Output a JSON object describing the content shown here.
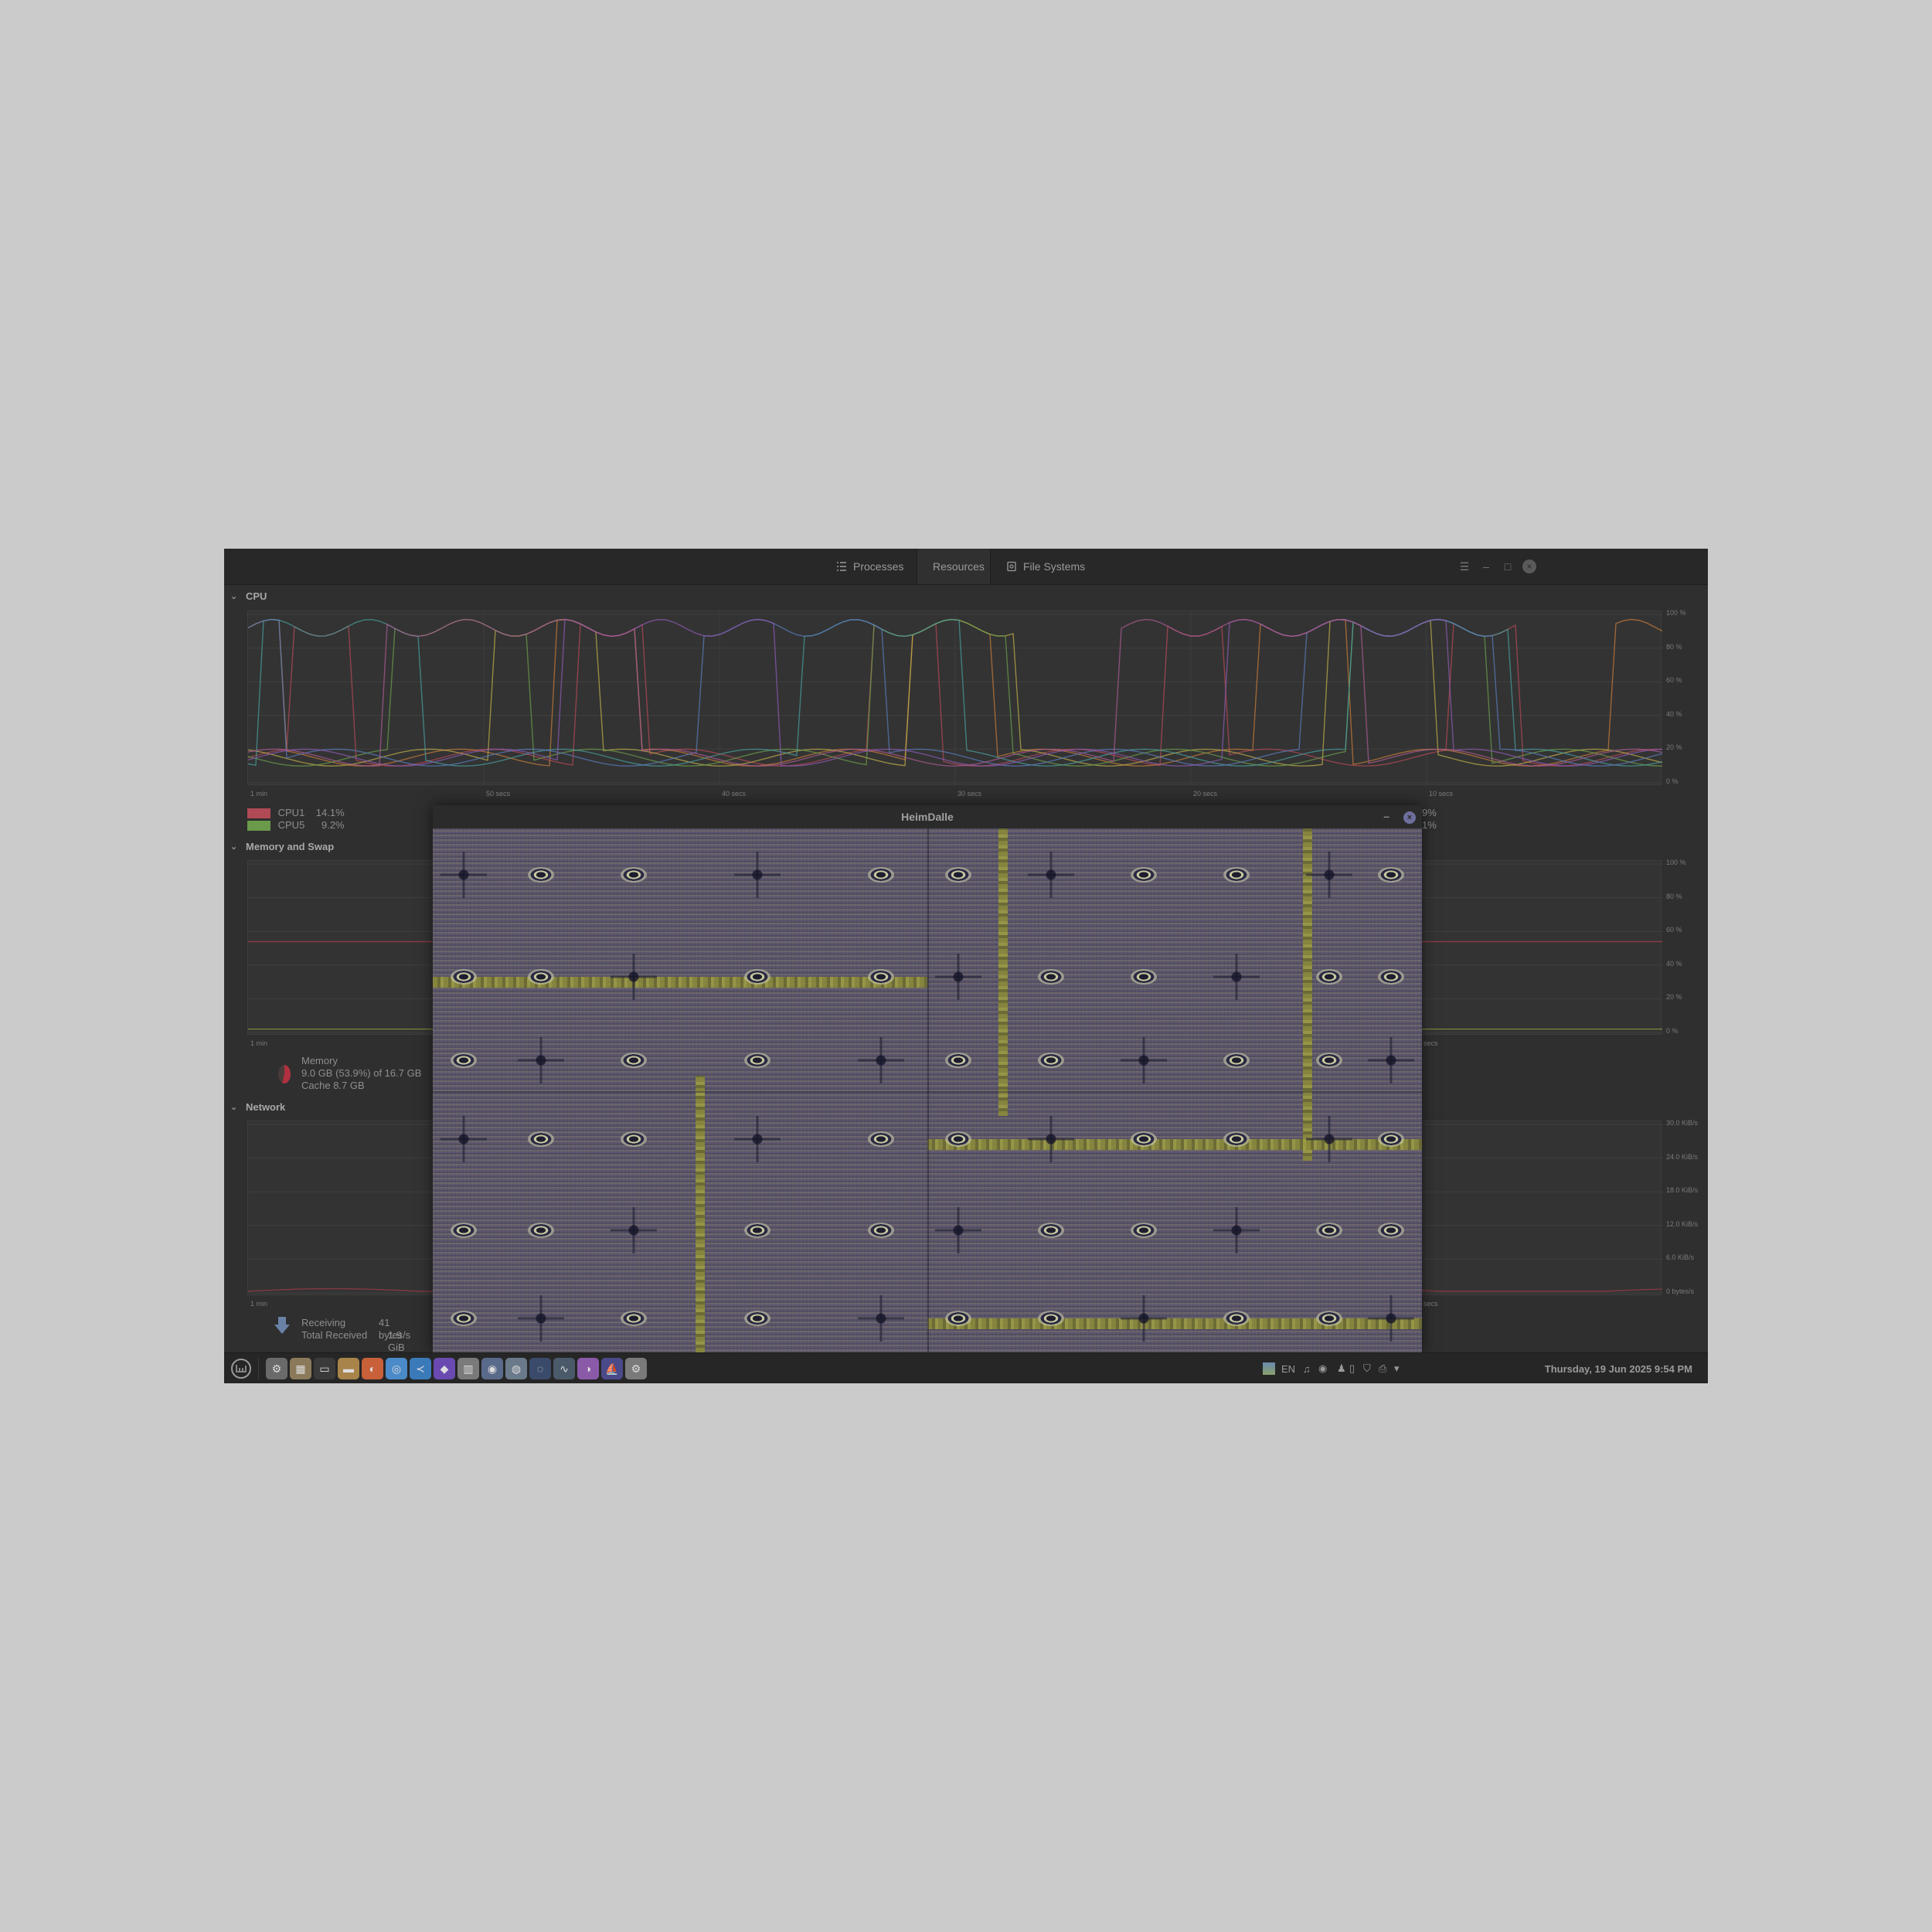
{
  "header": {
    "tabs": [
      {
        "label": "Processes",
        "icon": "list-icon"
      },
      {
        "label": "Resources",
        "icon": "gauge-icon"
      },
      {
        "label": "File Systems",
        "icon": "disk-icon"
      }
    ],
    "active_tab": "Resources"
  },
  "cpu": {
    "title": "CPU",
    "y_ticks": [
      "100 %",
      "80 %",
      "60 %",
      "40 %",
      "20 %",
      "0 %"
    ],
    "x_ticks": [
      "1 min",
      "50 secs",
      "40 secs",
      "30 secs",
      "20 secs",
      "10 secs"
    ],
    "legend": [
      {
        "name": "CPU1",
        "value": "14.1%",
        "color": "#b04a55"
      },
      {
        "name": "CPU5",
        "value": "9.2%",
        "color": "#6a9a4a"
      }
    ],
    "legend_right": [
      "9%",
      "1%"
    ]
  },
  "memory": {
    "title": "Memory and Swap",
    "y_ticks": [
      "100 %",
      "80 %",
      "60 %",
      "40 %",
      "20 %",
      "0 %"
    ],
    "x_ticks": [
      "1 min",
      "secs"
    ],
    "label": "Memory",
    "usage": "9.0 GB (53.9%) of 16.7 GB",
    "cache": "Cache 8.7 GB",
    "percent": 53.9
  },
  "network": {
    "title": "Network",
    "y_ticks": [
      "30.0 KiB/s",
      "24.0 KiB/s",
      "18.0 KiB/s",
      "12.0 KiB/s",
      "6.0 KiB/s",
      "0 bytes/s"
    ],
    "x_ticks": [
      "1 min",
      "secs"
    ],
    "receiving_label": "Receiving",
    "receiving_value": "41 bytes/s",
    "total_label": "Total Received",
    "total_value": "1.9 GiB"
  },
  "overlay_window": {
    "title": "HeimDalle",
    "minimize": "–",
    "close": "×"
  },
  "taskbar": {
    "language": "EN",
    "clock": "Thursday, 19 Jun 2025  9:54 PM",
    "apps": [
      "settings-icon",
      "files-icon",
      "terminal-icon",
      "folder-icon",
      "firefox-icon",
      "chrome-icon",
      "vscode-icon",
      "tor-icon",
      "notes-icon",
      "screenshot-icon",
      "disk-icon",
      "steam-icon",
      "monitor-icon",
      "palette-icon",
      "ship-icon",
      "gear-icon"
    ]
  },
  "colors": {
    "cpu_series": [
      "#b04a55",
      "#c07a3a",
      "#b8a84a",
      "#6a9a4a",
      "#4a9a9a",
      "#5a7ab8",
      "#8a5ab0",
      "#a85a90"
    ]
  }
}
